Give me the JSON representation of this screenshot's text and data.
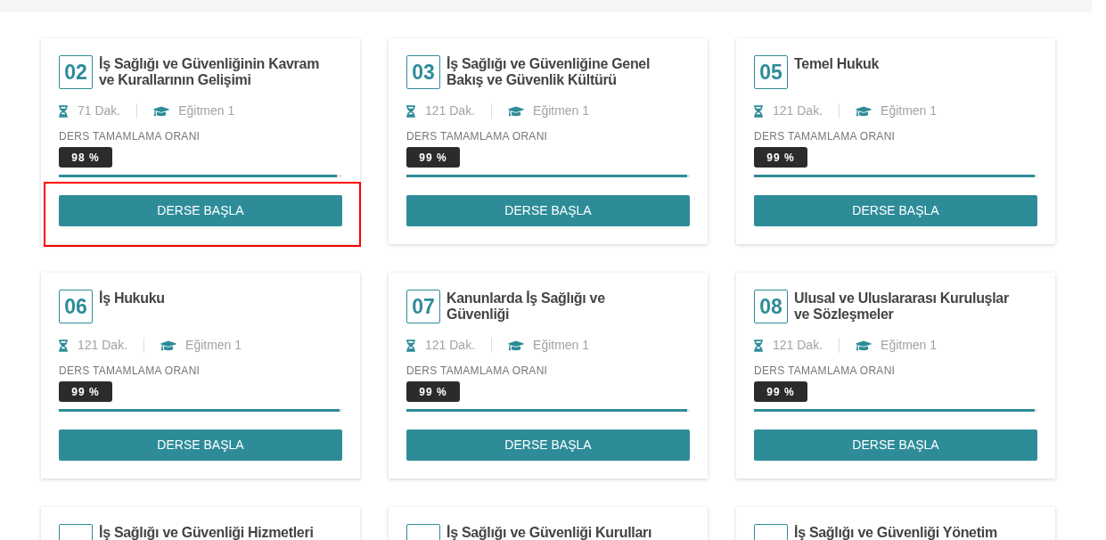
{
  "cards": [
    {
      "number": "02",
      "title": "İş Sağlığı ve Güvenliğinin Kavram ve Kurallarının Gelişimi",
      "duration": "71 Dak.",
      "instructor": "Eğitmen 1",
      "progress": {
        "label": "DERS TAMAMLAMA ORANI",
        "value": "98 %",
        "level": 0.98
      },
      "button": "DERSE BAŞLA",
      "highlighted": true
    },
    {
      "number": "03",
      "title": "İş Sağlığı ve Güvenliğine Genel Bakış ve Güvenlik Kültürü",
      "duration": "121 Dak.",
      "instructor": "Eğitmen 1",
      "progress": {
        "label": "DERS TAMAMLAMA ORANI",
        "value": "99 %",
        "level": 0.99
      },
      "button": "DERSE BAŞLA",
      "highlighted": false
    },
    {
      "number": "05",
      "title": "Temel Hukuk",
      "duration": "121 Dak.",
      "instructor": "Eğitmen 1",
      "progress": {
        "label": "DERS TAMAMLAMA ORANI",
        "value": "99 %",
        "level": 0.99
      },
      "button": "DERSE BAŞLA",
      "highlighted": false
    },
    {
      "number": "06",
      "title": "İş Hukuku",
      "duration": "121 Dak.",
      "instructor": "Eğitmen 1",
      "progress": {
        "label": "DERS TAMAMLAMA ORANI",
        "value": "99 %",
        "level": 0.99
      },
      "button": "DERSE BAŞLA",
      "highlighted": false
    },
    {
      "number": "07",
      "title": "Kanunlarda İş Sağlığı ve Güvenliği",
      "duration": "121 Dak.",
      "instructor": "Eğitmen 1",
      "progress": {
        "label": "DERS TAMAMLAMA ORANI",
        "value": "99 %",
        "level": 0.99
      },
      "button": "DERSE BAŞLA",
      "highlighted": false
    },
    {
      "number": "08",
      "title": "Ulusal ve Uluslararası Kuruluşlar ve Sözleşmeler",
      "duration": "121 Dak.",
      "instructor": "Eğitmen 1",
      "progress": {
        "label": "DERS TAMAMLAMA ORANI",
        "value": "99 %",
        "level": 0.99
      },
      "button": "DERSE BAŞLA",
      "highlighted": false
    },
    {
      "title": "İş Sağlığı ve Güvenliği Hizmetleri"
    },
    {
      "title": "İş Sağlığı ve Güvenliği Kurulları"
    },
    {
      "title": "İş Sağlığı ve Güvenliği Yönetim"
    }
  ]
}
